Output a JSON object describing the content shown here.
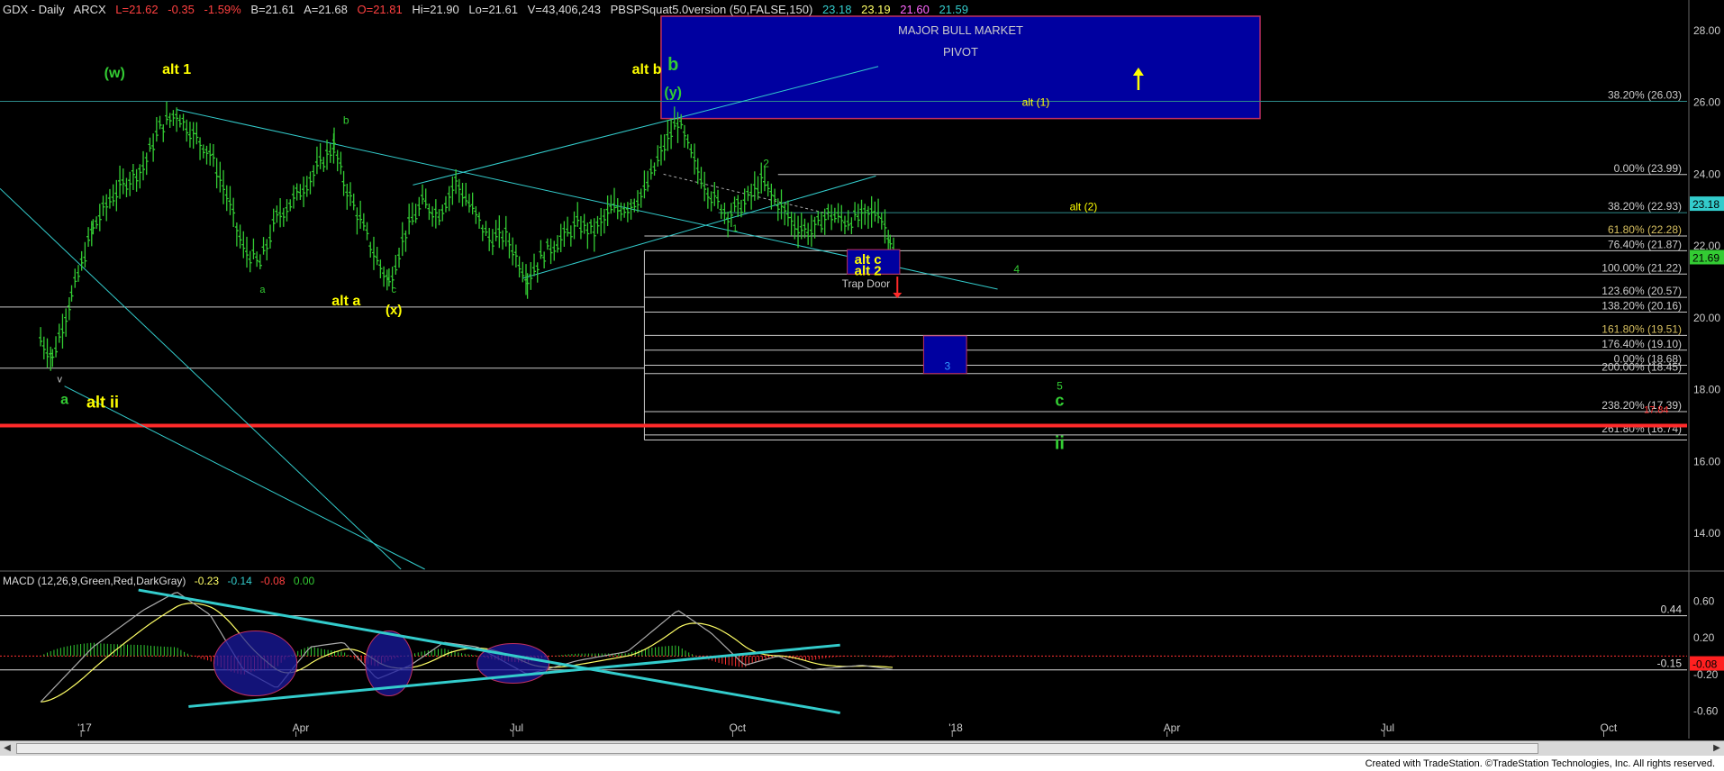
{
  "header": {
    "symbol": "GDX - Daily",
    "exchange": "ARCX",
    "last": "L=21.62",
    "change": "-0.35",
    "pct": "-1.59%",
    "bid": "B=21.61",
    "ask": "A=21.68",
    "open": "O=21.81",
    "high": "Hi=21.90",
    "low": "Lo=21.61",
    "volume": "V=43,406,243",
    "study": "PBSPSquat5.0version (50,FALSE,150)",
    "v1": "23.18",
    "v2": "23.19",
    "v3": "21.60",
    "v4": "21.59"
  },
  "macd_header": {
    "name": "MACD (12,26,9,Green,Red,DarkGray)",
    "v1": "-0.23",
    "v2": "-0.14",
    "v3": "-0.08",
    "v4": "0.00"
  },
  "colors": {
    "bar": "#33cc33",
    "fib": "#c8c8c8",
    "channel": "#33cccc",
    "trap": "#ff2a2a",
    "box": "#0000a0",
    "yellow": "#ffff00",
    "green": "#33cc33"
  },
  "annotations": {
    "major_bull_1": "MAJOR BULL MARKET",
    "major_bull_2": "PIVOT",
    "w": "(w)",
    "alt1": "alt 1",
    "b_small": "b",
    "a_small": "a",
    "alt_a": "alt a",
    "c_small": "c",
    "x": "(x)",
    "alt_b": "alt b",
    "b_big": "b",
    "y": "(y)",
    "alt_1_paren": "alt (1)",
    "two": "2",
    "one": "1",
    "alt_2_paren": "alt (2)",
    "alt_c": "alt c",
    "alt_2": "alt 2",
    "trap_door": "Trap Door",
    "four": "4",
    "three": "3",
    "five": "5",
    "c_big": "c",
    "ii": "ii",
    "v_small": "v",
    "a_big": "a",
    "alt_ii": "alt ii"
  },
  "fib_levels": [
    {
      "label": "38.20% (26.03)",
      "value": 26.03
    },
    {
      "label": "0.00% (23.99)",
      "value": 23.99
    },
    {
      "label": "38.20% (22.93)",
      "value": 22.93
    },
    {
      "label": "61.80% (22.28)",
      "value": 22.28
    },
    {
      "label": "76.40% (21.87)",
      "value": 21.87
    },
    {
      "label": "100.00% (21.22)",
      "value": 21.22
    },
    {
      "label": "123.60% (20.57)",
      "value": 20.57
    },
    {
      "label": "138.20% (20.16)",
      "value": 20.16
    },
    {
      "label": "161.80% (19.51)",
      "value": 19.51
    },
    {
      "label": "176.40% (19.10)",
      "value": 19.1
    },
    {
      "label": "0.00% (18.68)",
      "value": 18.68
    },
    {
      "label": "200.00% (18.45)",
      "value": 18.45
    },
    {
      "label": "238.20% (17.39)",
      "value": 17.39
    },
    {
      "label": "261.80% (16.74)",
      "value": 16.74
    }
  ],
  "chart_data": [
    {
      "type": "ohlc",
      "title": "GDX - Daily",
      "y_ticks": [
        28.0,
        26.0,
        24.0,
        22.0,
        20.0,
        18.0,
        16.0,
        14.0
      ],
      "ylim": [
        13.0,
        28.6
      ],
      "x_ticks": [
        "'17",
        "Apr",
        "Jul",
        "Oct",
        "'18",
        "Apr",
        "Jul",
        "Oct"
      ],
      "last_price": 21.69,
      "price_tags": [
        {
          "value": 23.18,
          "color": "#33cccc"
        },
        {
          "value": 21.69,
          "color": "#33cc33"
        }
      ],
      "other_label": "17.84",
      "close_path": [
        [
          "2016-12-15",
          19.4
        ],
        [
          "2016-12-20",
          18.9
        ],
        [
          "2016-12-28",
          20.6
        ],
        [
          "2017-01-06",
          22.5
        ],
        [
          "2017-01-13",
          23.3
        ],
        [
          "2017-01-20",
          23.8
        ],
        [
          "2017-01-27",
          24.2
        ],
        [
          "2017-02-03",
          25.3
        ],
        [
          "2017-02-10",
          25.7
        ],
        [
          "2017-02-17",
          25.1
        ],
        [
          "2017-02-24",
          24.6
        ],
        [
          "2017-03-03",
          23.4
        ],
        [
          "2017-03-10",
          21.9
        ],
        [
          "2017-03-17",
          21.5
        ],
        [
          "2017-03-24",
          22.8
        ],
        [
          "2017-03-31",
          23.3
        ],
        [
          "2017-04-07",
          23.9
        ],
        [
          "2017-04-17",
          24.8
        ],
        [
          "2017-04-21",
          23.8
        ],
        [
          "2017-04-28",
          22.7
        ],
        [
          "2017-05-05",
          21.6
        ],
        [
          "2017-05-10",
          21.0
        ],
        [
          "2017-05-17",
          22.4
        ],
        [
          "2017-05-24",
          23.2
        ],
        [
          "2017-05-31",
          22.9
        ],
        [
          "2017-06-07",
          23.8
        ],
        [
          "2017-06-14",
          23.0
        ],
        [
          "2017-06-21",
          22.2
        ],
        [
          "2017-06-28",
          22.3
        ],
        [
          "2017-07-07",
          21.1
        ],
        [
          "2017-07-14",
          21.8
        ],
        [
          "2017-07-21",
          22.2
        ],
        [
          "2017-07-28",
          22.6
        ],
        [
          "2017-08-04",
          22.4
        ],
        [
          "2017-08-11",
          23.0
        ],
        [
          "2017-08-18",
          23.1
        ],
        [
          "2017-08-25",
          23.5
        ],
        [
          "2017-09-01",
          24.6
        ],
        [
          "2017-09-08",
          25.5
        ],
        [
          "2017-09-15",
          24.3
        ],
        [
          "2017-09-22",
          23.4
        ],
        [
          "2017-09-29",
          22.9
        ],
        [
          "2017-10-06",
          23.2
        ],
        [
          "2017-10-13",
          23.8
        ],
        [
          "2017-10-20",
          23.2
        ],
        [
          "2017-10-27",
          22.6
        ],
        [
          "2017-11-03",
          22.4
        ],
        [
          "2017-11-10",
          22.9
        ],
        [
          "2017-11-17",
          22.7
        ],
        [
          "2017-11-24",
          22.8
        ],
        [
          "2017-12-01",
          23.0
        ],
        [
          "2017-12-06",
          22.2
        ],
        [
          "2017-12-08",
          21.7
        ]
      ]
    },
    {
      "type": "line",
      "title": "MACD (12,26,9,Green,Red,DarkGray)",
      "y_ticks": [
        0.6,
        0.2,
        -0.2,
        -0.6
      ],
      "ylim": [
        -0.85,
        0.75
      ],
      "ref_levels": [
        {
          "label": "0.44",
          "value": 0.44
        },
        {
          "label": "-0.15",
          "value": -0.15
        }
      ],
      "last_tag": "-0.08",
      "macd": [
        [
          "2016-12-15",
          -0.5
        ],
        [
          "2017-01-06",
          0.1
        ],
        [
          "2017-01-27",
          0.5
        ],
        [
          "2017-02-10",
          0.7
        ],
        [
          "2017-02-24",
          0.45
        ],
        [
          "2017-03-10",
          -0.15
        ],
        [
          "2017-03-24",
          -0.35
        ],
        [
          "2017-04-07",
          0.1
        ],
        [
          "2017-04-21",
          0.15
        ],
        [
          "2017-05-05",
          -0.25
        ],
        [
          "2017-05-19",
          -0.1
        ],
        [
          "2017-06-02",
          0.15
        ],
        [
          "2017-06-16",
          0.1
        ],
        [
          "2017-07-07",
          -0.2
        ],
        [
          "2017-07-28",
          -0.05
        ],
        [
          "2017-08-18",
          0.05
        ],
        [
          "2017-09-08",
          0.5
        ],
        [
          "2017-09-22",
          0.25
        ],
        [
          "2017-10-06",
          -0.1
        ],
        [
          "2017-10-20",
          0.0
        ],
        [
          "2017-11-03",
          -0.15
        ],
        [
          "2017-11-24",
          -0.1
        ],
        [
          "2017-12-08",
          -0.15
        ]
      ]
    }
  ],
  "footer": "Created with TradeStation. ©TradeStation Technologies, Inc. All rights reserved."
}
